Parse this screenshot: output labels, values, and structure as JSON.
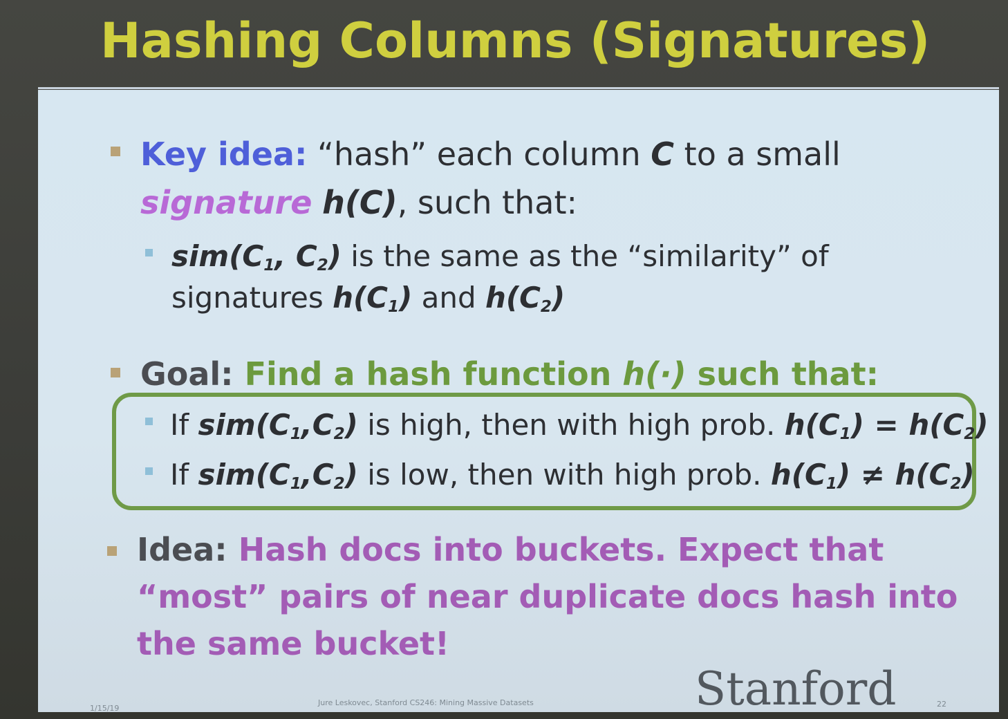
{
  "title": "Hashing Columns (Signatures)",
  "bullets": {
    "key_idea": {
      "label": "Key idea:",
      "text1": " “hash” each column ",
      "c": "C",
      "text2": " to a small",
      "signature": "signature",
      "space": " ",
      "hc": "h(C)",
      "text3": ", such that:",
      "sub": {
        "sim": "sim(C",
        "s1": "1",
        "comma": ", C",
        "s2": "2",
        "close": ")",
        "text1": " is the same as the “similarity” of",
        "text2": "signatures ",
        "h1": "h(C",
        "h1s": "1",
        "h1c": ")",
        "and": " and ",
        "h2": "h(C",
        "h2s": "2",
        "h2c": ")"
      }
    },
    "goal": {
      "label": "Goal:",
      "text1": " Find a hash function ",
      "h": "h(·)",
      "text2": " such that:",
      "items": [
        {
          "if": "If ",
          "sim": "sim(C",
          "s1": "1",
          "comma": ",C",
          "s2": "2",
          "close": ")",
          "text": " is high, then with high prob. ",
          "h1": "h(C",
          "h1s": "1",
          "op": ") = h(C",
          "h2s": "2",
          "h2c": ")"
        },
        {
          "if": "If ",
          "sim": "sim(C",
          "s1": "1",
          "comma": ",C",
          "s2": "2",
          "close": ")",
          "text": " is low, then with high prob. ",
          "h1": "h(C",
          "h1s": "1",
          "op": ") ≠ h(C",
          "h2s": "2",
          "h2c": ")"
        }
      ]
    },
    "idea": {
      "label": "Idea:",
      "line1": " Hash docs into buckets. Expect that",
      "line2": "“most” pairs of near duplicate docs hash into",
      "line3": "the same bucket!"
    }
  },
  "footer": {
    "date": "1/15/19",
    "credit": "Jure Leskovec, Stanford CS246: Mining Massive Datasets",
    "page": "22",
    "logo": "Stanford"
  },
  "colors": {
    "title": "#cfcf3f",
    "key_idea": "#4e5fd9",
    "signature": "#b869d6",
    "goal_text": "#6c9a3e",
    "idea_text": "#a35cb5",
    "box_border": "#6f9a47"
  }
}
